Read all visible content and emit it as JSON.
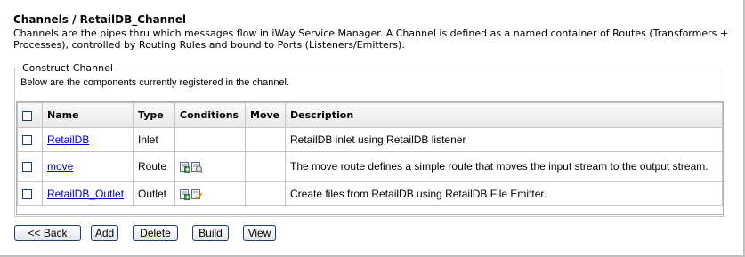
{
  "page": {
    "title": "Channels / RetailDB_Channel",
    "description": "Channels are the pipes thru which messages flow in iWay Service Manager. A Channel is defined as a named container of Routes (Transformers + Processes), controlled by Routing Rules and bound to Ports (Listeners/Emitters)."
  },
  "section": {
    "legend": "Construct Channel",
    "intro": "Below are the components currently registered in the channel."
  },
  "table": {
    "headers": {
      "name": "Name",
      "type": "Type",
      "conditions": "Conditions",
      "move": "Move",
      "description": "Description"
    },
    "rows": [
      {
        "name": "RetailDB",
        "type": "Inlet",
        "description": "RetailDB inlet using RetailDB listener",
        "condition_icons": []
      },
      {
        "name": "move",
        "type": "Route",
        "description": "The move route defines a simple route that moves the input stream to the output stream.",
        "condition_icons": [
          "add-condition-icon",
          "view-condition-icon"
        ]
      },
      {
        "name": "RetailDB_Outlet",
        "type": "Outlet",
        "description": "Create files from RetailDB using RetailDB File Emitter.",
        "condition_icons": [
          "add-condition-icon",
          "edit-condition-icon"
        ]
      }
    ]
  },
  "buttons": {
    "back": "<< Back",
    "add": "Add",
    "delete": "Delete",
    "build": "Build",
    "view": "View"
  },
  "colors": {
    "link": "#0000cc",
    "checkbox_border": "#1c3e74",
    "button_border": "#1c3e74",
    "header_bg": "#eeeeee"
  }
}
